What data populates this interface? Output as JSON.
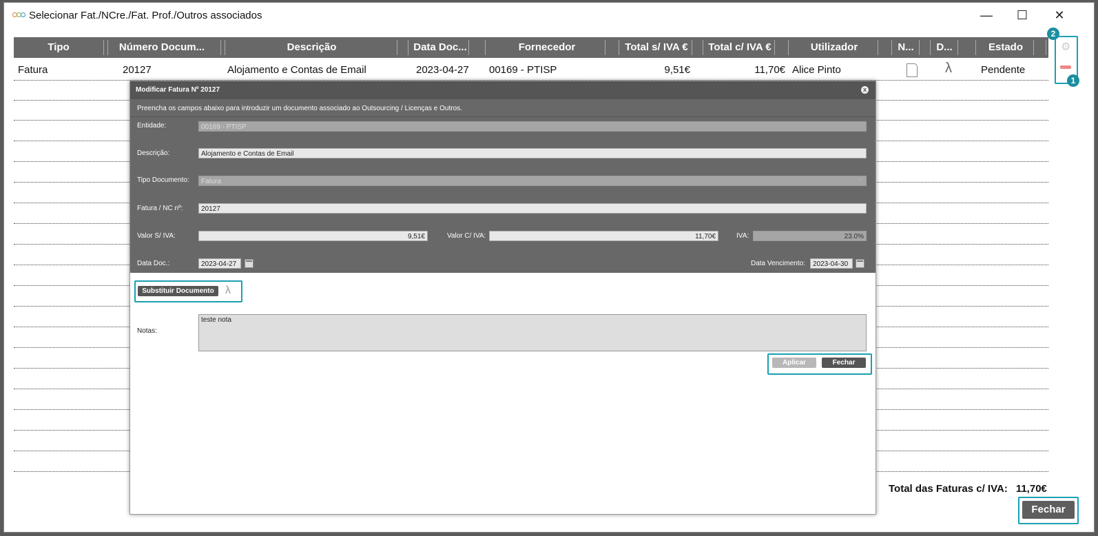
{
  "window": {
    "title": "Selecionar Fat./NCre./Fat. Prof./Outros associados"
  },
  "table": {
    "headers": [
      "Tipo",
      "Número Docum...",
      "Descrição",
      "Data Doc...",
      "Fornecedor",
      "Total s/ IVA €",
      "Total c/ IVA €",
      "Utilizador",
      "N...",
      "D...",
      "Estado"
    ],
    "row": {
      "tipo": "Fatura",
      "numero": "20127",
      "descricao": "Alojamento e Contas de Email",
      "data": "2023-04-27",
      "fornecedor": "00169 - PTISP",
      "total_s_iva": "9,51€",
      "total_c_iva": "11,70€",
      "utilizador": "Alice Pinto",
      "estado": "Pendente"
    }
  },
  "side": {
    "badge1": "1",
    "badge2": "2"
  },
  "totals": {
    "label": "Total das Faturas c/ IVA:",
    "value": "11,70€"
  },
  "footer": {
    "close_label": "Fechar"
  },
  "modal": {
    "title": "Modificar Fatura Nº 20127",
    "close_glyph": "x",
    "intro": "Preencha os campos abaixo para introduzir um documento associado ao Outsourcing / Licenças e Outros.",
    "entidade": {
      "label": "Entidade:",
      "value": "00169 - PTISP"
    },
    "descricao": {
      "label": "Descrição:",
      "value": "Alojamento e Contas de Email"
    },
    "tipo": {
      "label": "Tipo Documento:",
      "value": "Fatura"
    },
    "fatura_nc": {
      "label": "Fatura / NC nº:",
      "value": "20127"
    },
    "valor_s_iva": {
      "label": "Valor S/ IVA:",
      "value": "9,51€"
    },
    "valor_c_iva": {
      "label": "Valor C/ IVA:",
      "value": "11,70€"
    },
    "iva": {
      "label": "IVA:",
      "value": "23.0%"
    },
    "data_doc": {
      "label": "Data Doc.:",
      "value": "2023-04-27"
    },
    "data_venc": {
      "label": "Data Vencimento:",
      "value": "2023-04-30"
    },
    "substituir_label": "Substituir Documento",
    "notas": {
      "label": "Notas:",
      "value": "teste nota"
    },
    "aplicar_label": "Aplicar",
    "fechar_label": "Fechar"
  },
  "colors": {
    "accent": "#19a0b3",
    "header_bg": "#686868",
    "modal_body": "#686868"
  }
}
